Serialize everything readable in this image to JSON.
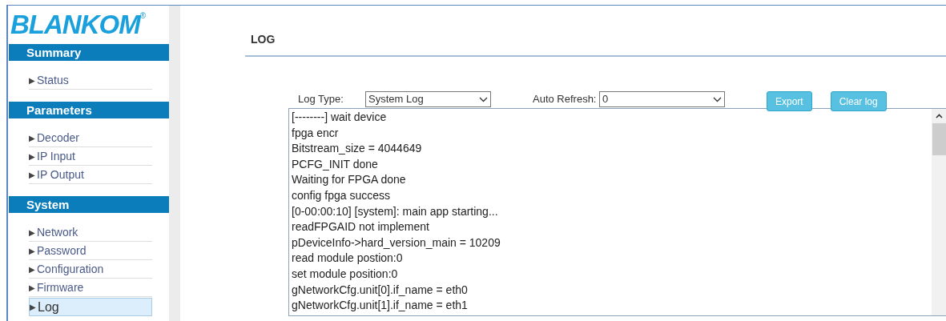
{
  "logo": {
    "text": "BLANKOM",
    "mark": "®"
  },
  "sidebar": {
    "sections": [
      {
        "title": "Summary",
        "items": [
          {
            "label": "Status",
            "selected": false
          }
        ]
      },
      {
        "title": "Parameters",
        "items": [
          {
            "label": "Decoder",
            "selected": false
          },
          {
            "label": "IP Input",
            "selected": false
          },
          {
            "label": "IP Output",
            "selected": false
          }
        ]
      },
      {
        "title": "System",
        "items": [
          {
            "label": "Network",
            "selected": false
          },
          {
            "label": "Password",
            "selected": false
          },
          {
            "label": "Configuration",
            "selected": false
          },
          {
            "label": "Firmware",
            "selected": false
          },
          {
            "label": "Log",
            "selected": true
          }
        ]
      }
    ],
    "arrow": "▶"
  },
  "page_title": "LOG",
  "log_type": {
    "label": "Log Type:",
    "value": "System Log"
  },
  "auto_refresh": {
    "label": "Auto Refresh:",
    "value": "0"
  },
  "buttons": [
    "Export",
    "Clear log"
  ],
  "log_lines": [
    "[--------] wait device",
    "fpga encr",
    "Bitstream_size = 4044649",
    "PCFG_INIT done",
    "Waiting for FPGA done",
    "config fpga success",
    "[0-00:00:10] [system]: main app starting...",
    "readFPGAID not implement",
    "pDeviceInfo->hard_version_main = 10209",
    "read module postion:0",
    "set module position:0",
    "gNetworkCfg.unit[0].if_name = eth0",
    "gNetworkCfg.unit[1].if_name = eth1"
  ]
}
